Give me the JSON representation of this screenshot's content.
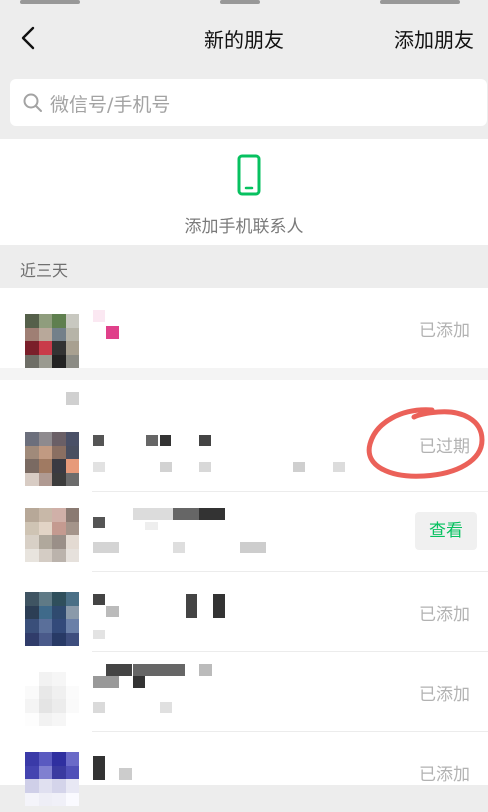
{
  "nav": {
    "title": "新的朋友",
    "action": "添加朋友"
  },
  "search": {
    "placeholder": "微信号/手机号"
  },
  "phone_contacts": {
    "label": "添加手机联系人"
  },
  "section": {
    "title": "近三天"
  },
  "requests": [
    {
      "status": "已添加"
    },
    {
      "status": "已过期"
    },
    {
      "status": "查看"
    },
    {
      "status": "已添加"
    },
    {
      "status": "已添加"
    },
    {
      "status": "已添加"
    }
  ],
  "colors": {
    "accent": "#07c160",
    "annotation": "#e8453c",
    "muted": "#b2b2b2"
  }
}
